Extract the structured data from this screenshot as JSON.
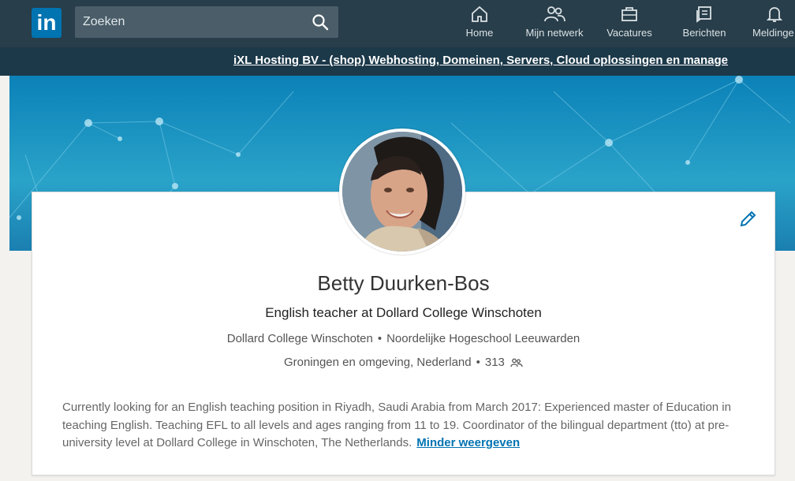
{
  "header": {
    "logo_text": "in",
    "search": {
      "placeholder": "Zoeken"
    },
    "nav": [
      {
        "label": "Home",
        "icon": "home-icon"
      },
      {
        "label": "Mijn netwerk",
        "icon": "network-icon"
      },
      {
        "label": "Vacatures",
        "icon": "jobs-icon"
      },
      {
        "label": "Berichten",
        "icon": "messages-icon"
      },
      {
        "label": "Meldinge",
        "icon": "bell-icon"
      }
    ]
  },
  "ad": {
    "text": "iXL Hosting BV - (shop) Webhosting, Domeinen, Servers, Cloud oplossingen en manage"
  },
  "profile": {
    "name": "Betty Duurken-Bos",
    "headline": "English teacher at Dollard College Winschoten",
    "organization_1": "Dollard College Winschoten",
    "organization_2": "Noordelijke Hogeschool Leeuwarden",
    "location": "Groningen en omgeving, Nederland",
    "connections": "313",
    "summary": "Currently looking for an English teaching position in Riyadh, Saudi Arabia from March 2017: Experienced master of Education in teaching English. Teaching EFL to all levels and ages ranging from 11 to 19. Coordinator of the bilingual department (tto) at pre-university level at Dollard College in Winschoten, The Netherlands.",
    "show_less": "Minder weergeven"
  },
  "colors": {
    "topbar": "#283e4a",
    "brand": "#0073b1",
    "link": "#0073b1"
  }
}
